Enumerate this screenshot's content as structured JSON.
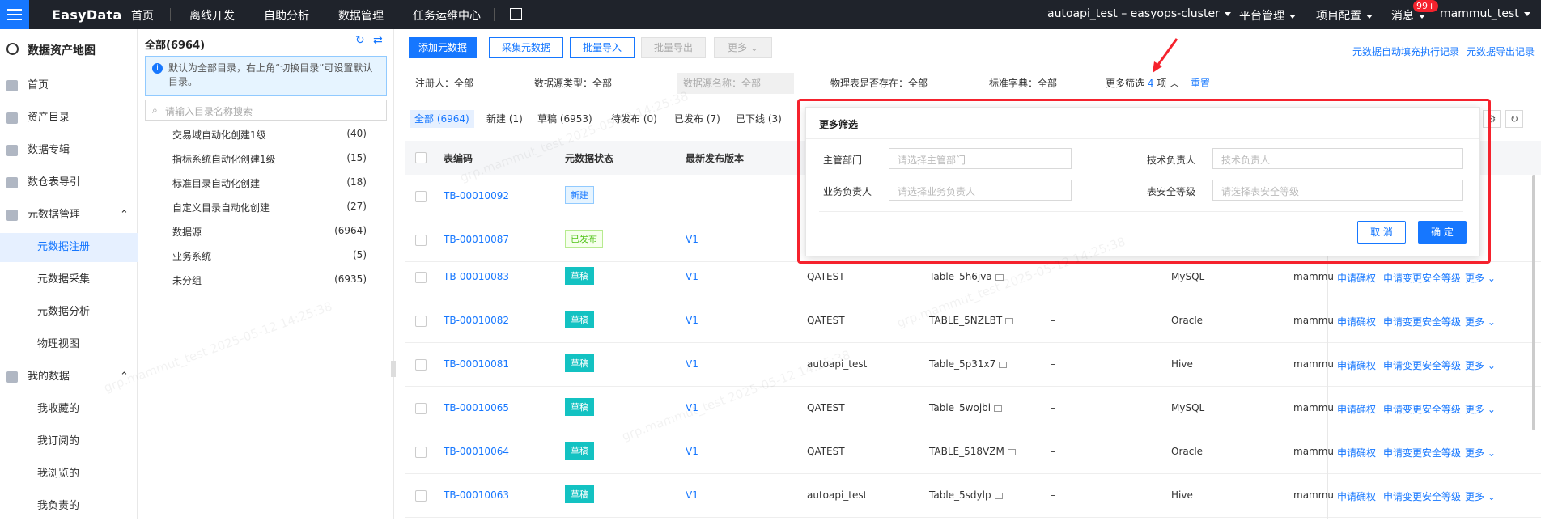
{
  "topbar": {
    "logo": "EasyData",
    "nav": [
      "首页",
      "离线开发",
      "自助分析",
      "数据管理",
      "任务运维中心"
    ],
    "cluster": "autoapi_test – easyops-cluster",
    "platform": "平台管理",
    "project": "项目配置",
    "messages": "消息",
    "badge": "99+",
    "user": "mammut_test"
  },
  "sidebar": {
    "title": "数据资产地图",
    "items": [
      "首页",
      "资产目录",
      "数据专辑",
      "数仓表导引",
      "元数据管理",
      "元数据注册",
      "元数据采集",
      "元数据分析",
      "物理视图",
      "我的数据",
      "我收藏的",
      "我订阅的",
      "我浏览的",
      "我负责的"
    ]
  },
  "tree": {
    "title": "全部(6964)",
    "info": "默认为全部目录，右上角“切换目录”可设置默认目录。",
    "search_placeholder": "请输入目录名称搜索",
    "items": [
      {
        "label": "交易域自动化创建1级",
        "count": "(40)"
      },
      {
        "label": "指标系统自动化创建1级",
        "count": "(15)"
      },
      {
        "label": "标准目录自动化创建",
        "count": "(18)"
      },
      {
        "label": "自定义目录自动化创建",
        "count": "(27)"
      },
      {
        "label": "数据源",
        "count": "(6964)"
      },
      {
        "label": "业务系统",
        "count": "(5)"
      },
      {
        "label": "未分组",
        "count": "(6935)"
      }
    ]
  },
  "toolbar": {
    "buttons": [
      "添加元数据",
      "采集元数据",
      "批量导入",
      "批量导出",
      "更多"
    ],
    "links": [
      "元数据自动填充执行记录",
      "元数据导出记录"
    ]
  },
  "filters": {
    "registrant": "注册人：全部",
    "source_type": "数据源类型：全部",
    "source_name": "数据源名称：全部",
    "physical": "物理表是否存在：全部",
    "standard": "标准字典：全部",
    "more": "更多筛选",
    "count": "4",
    "unit": "项",
    "reset": "重置"
  },
  "tabs": [
    "全部 (6964)",
    "新建 (1)",
    "草稿 (6953)",
    "待发布 (0)",
    "已发布 (7)",
    "已下线 (3)"
  ],
  "table": {
    "headers": [
      "表编码",
      "元数据状态",
      "最新发布版本"
    ],
    "rows": [
      {
        "code": "TB-00010092",
        "status": "新建",
        "ver": "",
        "src": "",
        "name": "",
        "desc": "",
        "db": "",
        "owner": ""
      },
      {
        "code": "TB-00010087",
        "status": "已发布",
        "ver": "V1",
        "src": "",
        "name": "",
        "desc": "",
        "db": "",
        "owner": ""
      },
      {
        "code": "TB-00010083",
        "status": "草稿",
        "ver": "V1",
        "src": "QATEST",
        "name": "Table_5h6jva",
        "desc": "–",
        "db": "MySQL",
        "owner": "mammu"
      },
      {
        "code": "TB-00010082",
        "status": "草稿",
        "ver": "V1",
        "src": "QATEST",
        "name": "TABLE_5NZLBT",
        "desc": "–",
        "db": "Oracle",
        "owner": "mammu"
      },
      {
        "code": "TB-00010081",
        "status": "草稿",
        "ver": "V1",
        "src": "autoapi_test",
        "name": "Table_5p31x7",
        "desc": "–",
        "db": "Hive",
        "owner": "mammu"
      },
      {
        "code": "TB-00010065",
        "status": "草稿",
        "ver": "V1",
        "src": "QATEST",
        "name": "Table_5wojbi",
        "desc": "–",
        "db": "MySQL",
        "owner": "mammu"
      },
      {
        "code": "TB-00010064",
        "status": "草稿",
        "ver": "V1",
        "src": "QATEST",
        "name": "TABLE_518VZM",
        "desc": "–",
        "db": "Oracle",
        "owner": "mammu"
      },
      {
        "code": "TB-00010063",
        "status": "草稿",
        "ver": "V1",
        "src": "autoapi_test",
        "name": "Table_5sdylp",
        "desc": "–",
        "db": "Hive",
        "owner": "mammu"
      }
    ],
    "actions": [
      "申请确权",
      "申请变更安全等级",
      "更多"
    ]
  },
  "popup": {
    "title": "更多筛选",
    "dept_label": "主管部门",
    "dept_ph": "请选择主管部门",
    "tech_label": "技术负责人",
    "tech_ph": "技术负责人",
    "biz_label": "业务负责人",
    "biz_ph": "请选择业务负责人",
    "level_label": "表安全等级",
    "level_ph": "请选择表安全等级",
    "cancel": "取 消",
    "ok": "确 定"
  },
  "watermark": "grp.mammut_test 2025-05-12 14:25:38",
  "colors": {
    "accent": "#1677ff",
    "highlight": "#f5222d",
    "topbar": "#1f232b"
  }
}
